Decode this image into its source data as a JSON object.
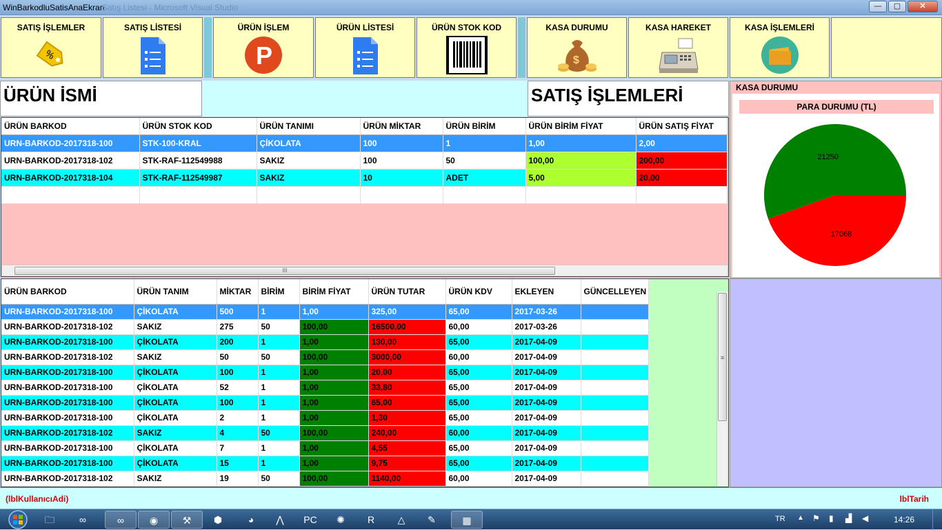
{
  "window": {
    "title": "WinBarkodluSatisAnaEkran",
    "ghost_title": "Satış Listesi - Microsoft Visual Studio",
    "min": "—",
    "max": "▢",
    "close": "✕"
  },
  "toolbar": [
    {
      "label": "SATIŞ İŞLEMLER",
      "icon": "discount-tag-icon"
    },
    {
      "label": "SATIŞ LİSTESİ",
      "icon": "document-list-icon"
    },
    {
      "label": "ÜRÜN İŞLEM",
      "icon": "p-circle-icon"
    },
    {
      "label": "ÜRÜN LİSTESİ",
      "icon": "document-list-icon"
    },
    {
      "label": "ÜRÜN STOK KOD",
      "icon": "barcode-icon"
    },
    {
      "label": "KASA DURUMU",
      "icon": "money-bag-icon"
    },
    {
      "label": "KASA HAREKET",
      "icon": "cash-register-icon"
    },
    {
      "label": "KASA İŞLEMLERİ",
      "icon": "wallet-icon"
    }
  ],
  "header": {
    "urun_ismi": "ÜRÜN İSMİ",
    "satis_islemleri": "SATIŞ İŞLEMLERİ"
  },
  "top_grid": {
    "columns": [
      "ÜRÜN BARKOD",
      "ÜRÜN STOK KOD",
      "ÜRÜN TANIMI",
      "ÜRÜN MİKTAR",
      "ÜRÜN BİRİM",
      "ÜRÜN BİRİM FİYAT",
      "ÜRÜN SATIŞ FİYAT"
    ],
    "rows": [
      [
        "URN-BARKOD-2017318-100",
        "STK-100-KRAL",
        "ÇİKOLATA",
        "100",
        "1",
        "1,00",
        "2,00"
      ],
      [
        "URN-BARKOD-2017318-102",
        "STK-RAF-112549988",
        "SAKIZ",
        "100",
        "50",
        "100,00",
        "200,00"
      ],
      [
        "URN-BARKOD-2017318-104",
        "STK-RAF-112549987",
        "SAKIZ",
        "10",
        "ADET",
        "5,00",
        "20,00"
      ],
      [
        "",
        "",
        "",
        "",
        "",
        "",
        ""
      ]
    ],
    "scroll_thumb": "III"
  },
  "bottom_grid": {
    "columns": [
      "ÜRÜN BARKOD",
      "ÜRÜN TANIM",
      "MİKTAR",
      "BİRİM",
      "BİRİM FİYAT",
      "ÜRÜN TUTAR",
      "ÜRÜN KDV",
      "EKLEYEN",
      "GÜNCELLEYEN"
    ],
    "rows": [
      [
        "URN-BARKOD-2017318-100",
        "ÇİKOLATA",
        "500",
        "1",
        "1,00",
        "325,00",
        "65,00",
        "2017-03-26",
        ""
      ],
      [
        "URN-BARKOD-2017318-102",
        "SAKIZ",
        "275",
        "50",
        "100,00",
        "16500,00",
        "60,00",
        "2017-03-26",
        ""
      ],
      [
        "URN-BARKOD-2017318-100",
        "ÇİKOLATA",
        "200",
        "1",
        "1,00",
        "130,00",
        "65,00",
        "2017-04-09",
        ""
      ],
      [
        "URN-BARKOD-2017318-102",
        "SAKIZ",
        "50",
        "50",
        "100,00",
        "3000,00",
        "60,00",
        "2017-04-09",
        ""
      ],
      [
        "URN-BARKOD-2017318-100",
        "ÇİKOLATA",
        "100",
        "1",
        "1,00",
        "20,00",
        "65,00",
        "2017-04-09",
        ""
      ],
      [
        "URN-BARKOD-2017318-100",
        "ÇİKOLATA",
        "52",
        "1",
        "1,00",
        "33,80",
        "65,00",
        "2017-04-09",
        ""
      ],
      [
        "URN-BARKOD-2017318-100",
        "ÇİKOLATA",
        "100",
        "1",
        "1,00",
        "65,00",
        "65,00",
        "2017-04-09",
        ""
      ],
      [
        "URN-BARKOD-2017318-100",
        "ÇİKOLATA",
        "2",
        "1",
        "1,00",
        "1,30",
        "65,00",
        "2017-04-09",
        ""
      ],
      [
        "URN-BARKOD-2017318-102",
        "SAKIZ",
        "4",
        "50",
        "100,00",
        "240,00",
        "60,00",
        "2017-04-09",
        ""
      ],
      [
        "URN-BARKOD-2017318-100",
        "ÇİKOLATA",
        "7",
        "1",
        "1,00",
        "4,55",
        "65,00",
        "2017-04-09",
        ""
      ],
      [
        "URN-BARKOD-2017318-100",
        "ÇİKOLATA",
        "15",
        "1",
        "1,00",
        "9,75",
        "65,00",
        "2017-04-09",
        ""
      ],
      [
        "URN-BARKOD-2017318-102",
        "SAKIZ",
        "19",
        "50",
        "100,00",
        "1140,00",
        "60,00",
        "2017-04-09",
        ""
      ]
    ],
    "scroll_grip": "≡"
  },
  "kasa": {
    "title": "KASA DURUMU",
    "chart_title": "PARA DURUMU (TL)"
  },
  "chart_data": {
    "type": "pie",
    "title": "PARA DURUMU (TL)",
    "slices": [
      {
        "value": 21250,
        "label": "21250",
        "color": "#008000"
      },
      {
        "value": 17068,
        "label": "17068",
        "color": "#ff0000"
      }
    ]
  },
  "status": {
    "user": "(lblKullanıcıAdi)",
    "date": "lblTarih"
  },
  "taskbar": {
    "items": [
      "folder-icon",
      "visual-studio-icon",
      "visual-studio-icon",
      "chrome-icon",
      "tools-icon",
      "box-icon",
      "firefox-icon",
      "app-icon",
      "pycharm-icon",
      "paint-icon",
      "r-icon",
      "drive-icon",
      "notepad-icon",
      "calculator-icon"
    ],
    "glyphs": [
      "🗀",
      "∞",
      "∞",
      "◉",
      "⚒",
      "⬢",
      "◕",
      "⋀",
      "PC",
      "✺",
      "R",
      "△",
      "✎",
      "▦"
    ],
    "lang": "TR",
    "time": "14:26"
  },
  "colors": {
    "toolbar_bg": "#ffffc0",
    "grid_bg": "#ffc0c0",
    "selected": "#3399ff",
    "alt_row": "#00ffff",
    "lime": "#adff2f",
    "red": "#ff0000",
    "green": "#008000"
  }
}
